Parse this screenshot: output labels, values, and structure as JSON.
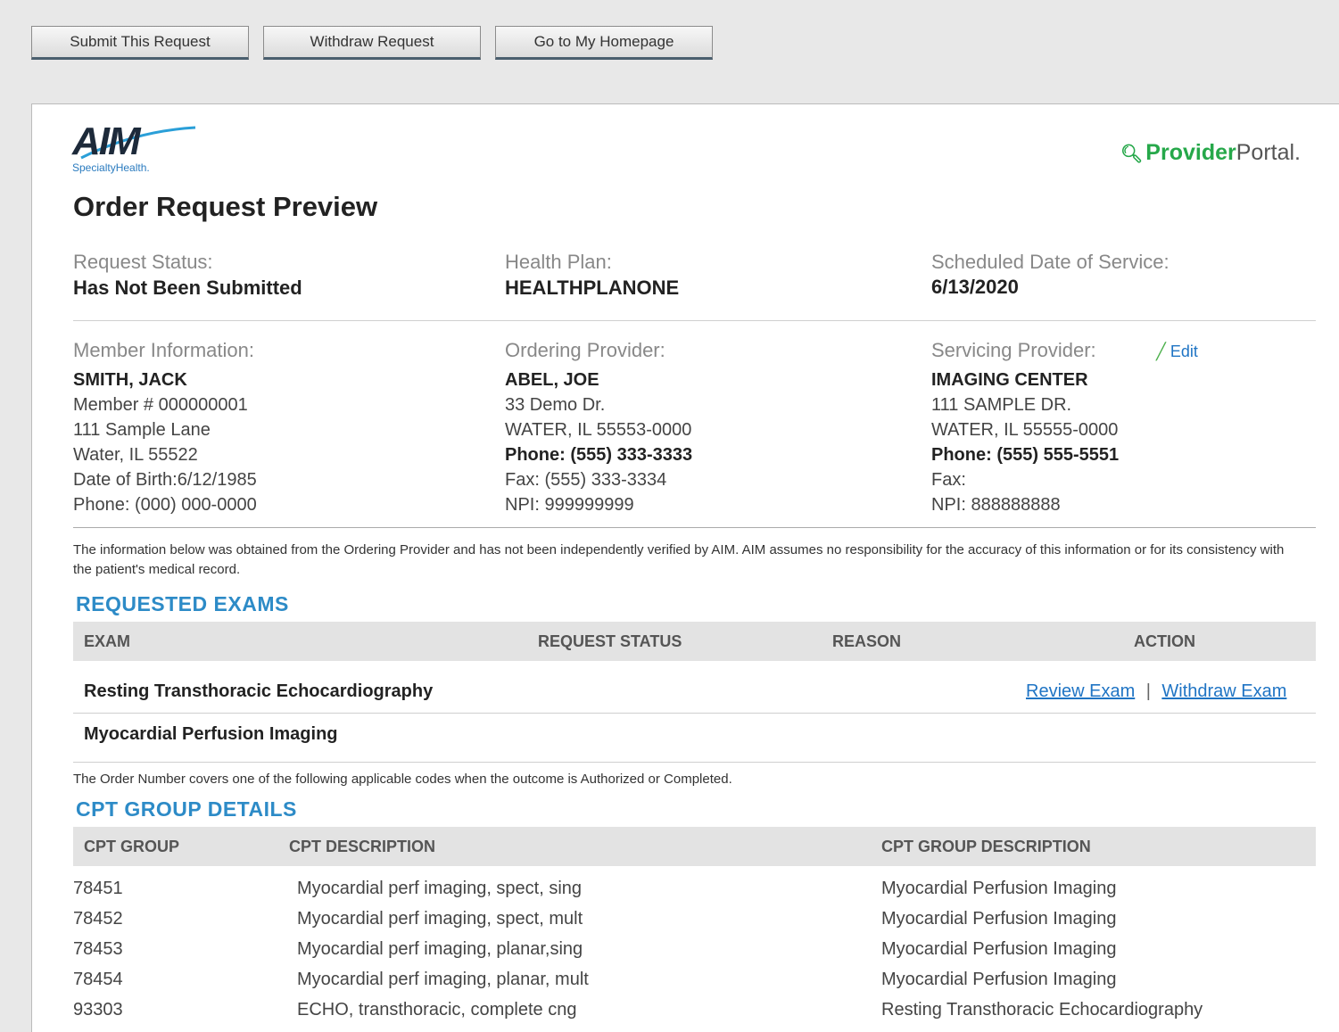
{
  "toolbar": {
    "submit_label": "Submit This Request",
    "withdraw_label": "Withdraw Request",
    "home_label": "Go to My Homepage"
  },
  "brand": {
    "logo_text": "AIM",
    "logo_sub": "SpecialtyHealth.",
    "portal_bold": "Provider",
    "portal_thin": "Portal."
  },
  "page_title": "Order Request Preview",
  "summary": {
    "request_status_label": "Request Status:",
    "request_status_value": "Has Not Been Submitted",
    "health_plan_label": "Health Plan:",
    "health_plan_value": "HEALTHPLANONE",
    "service_date_label": "Scheduled Date of Service:",
    "service_date_value": "6/13/2020"
  },
  "member": {
    "label": "Member Information:",
    "name": "SMITH, JACK",
    "member_no": "Member # 000000001",
    "address1": "111 Sample Lane",
    "address2": "Water, IL 55522",
    "dob_label": "Date of Birth:",
    "dob_value": "6/12/1985",
    "phone": "Phone: (000) 000-0000"
  },
  "ordering": {
    "label": "Ordering Provider:",
    "name": "ABEL, JOE",
    "address1": "33 Demo Dr.",
    "address2": "WATER, IL 55553-0000",
    "phone": "Phone: (555) 333-3333",
    "fax": "Fax: (555) 333-3334",
    "npi": "NPI: 999999999"
  },
  "servicing": {
    "label": "Servicing Provider:",
    "edit_label": "Edit",
    "name": "IMAGING CENTER",
    "address1": "111 SAMPLE DR.",
    "address2": "WATER, IL 55555-0000",
    "phone": "Phone: (555) 555-5551",
    "fax": "Fax:",
    "npi": "NPI: 888888888"
  },
  "disclaimer": "The information below was obtained from the Ordering Provider and has not been independently verified by AIM. AIM assumes no responsibility for the accuracy of this information or for its consistency with the patient's medical record.",
  "exams": {
    "heading": "REQUESTED EXAMS",
    "col_exam": "EXAM",
    "col_status": "REQUEST STATUS",
    "col_reason": "REASON",
    "col_action": "ACTION",
    "rows": [
      {
        "exam": "Resting Transthoracic Echocardiography",
        "review": "Review Exam",
        "sep": "|",
        "withdraw": "Withdraw Exam"
      },
      {
        "exam": "Myocardial Perfusion Imaging"
      }
    ]
  },
  "cpt_note": "The Order Number covers one of the following applicable codes when the outcome is Authorized or Completed.",
  "cpt": {
    "heading": "CPT GROUP DETAILS",
    "col_group": "CPT GROUP",
    "col_desc": "CPT DESCRIPTION",
    "col_group_desc": "CPT GROUP DESCRIPTION",
    "rows": [
      {
        "code": "78451",
        "desc": "Myocardial perf imaging, spect, sing",
        "group": "Myocardial Perfusion Imaging"
      },
      {
        "code": "78452",
        "desc": "Myocardial perf imaging, spect, mult",
        "group": "Myocardial Perfusion Imaging"
      },
      {
        "code": "78453",
        "desc": "Myocardial perf imaging, planar,sing",
        "group": "Myocardial Perfusion Imaging"
      },
      {
        "code": "78454",
        "desc": "Myocardial perf imaging, planar, mult",
        "group": "Myocardial Perfusion Imaging"
      },
      {
        "code": "93303",
        "desc": "ECHO, transthoracic, complete cng",
        "group": "Resting Transthoracic Echocardiography"
      }
    ]
  }
}
